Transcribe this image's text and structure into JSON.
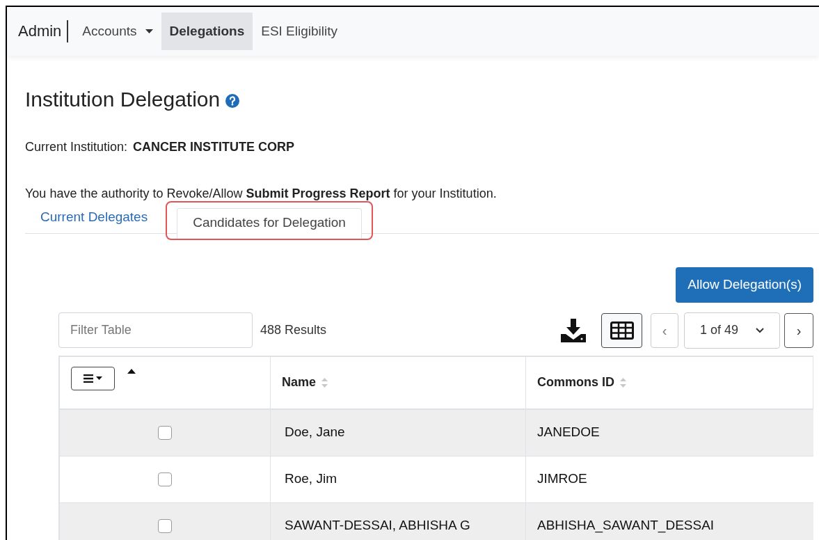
{
  "navbar": {
    "brand": "Admin",
    "items": [
      {
        "label": "Accounts",
        "dropdown": true,
        "selected": false
      },
      {
        "label": "Delegations",
        "dropdown": false,
        "selected": true
      },
      {
        "label": "ESI Eligibility",
        "dropdown": false,
        "selected": false
      }
    ]
  },
  "page": {
    "title": "Institution Delegation",
    "institution_label": "Current Institution:",
    "institution": "CANCER INSTITUTE CORP",
    "authority_text": "You have the authority to Revoke/Allow **Submit Progress Report** for your Institution."
  },
  "tabs": [
    {
      "label": "Current Delegates",
      "selected": false,
      "highlighted": false
    },
    {
      "label": "Candidates for Delegation",
      "selected": true,
      "highlighted": true
    }
  ],
  "primary_button": "Allow Delegation(s)",
  "toolbar": {
    "filter_placeholder": "Filter Table",
    "results": "488 Results",
    "page_select": "1 of 49",
    "prev": "‹",
    "next": "›"
  },
  "table": {
    "columns": [
      "Name",
      "Commons ID"
    ],
    "sorted_ascending": true,
    "rows": [
      {
        "checked": false,
        "name": "Doe, Jane",
        "commons_id": "JANEDOE"
      },
      {
        "checked": false,
        "name": "Roe, Jim",
        "commons_id": "JIMROE"
      },
      {
        "checked": false,
        "name": "SAWANT-DESSAI, ABHISHA G",
        "commons_id": "ABHISHA_SAWANT_DESSAI"
      }
    ]
  }
}
